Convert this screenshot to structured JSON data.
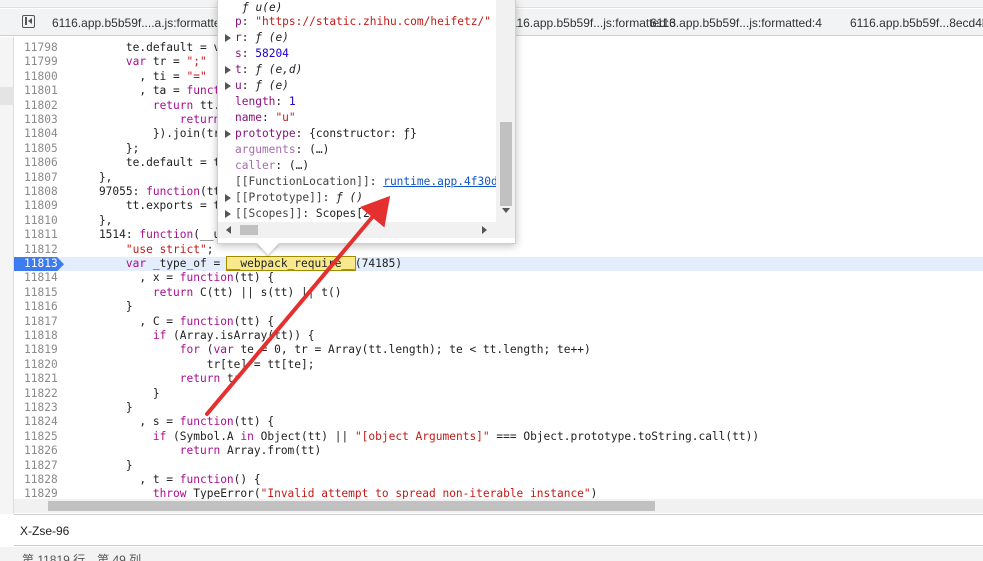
{
  "tabs": [
    {
      "label": "6116.app.b5b59f....a.js:formatted"
    },
    {
      "label": "6116.app.b5b59f...js:formatted:3"
    },
    {
      "label": "6116.app.b5b59f...js:formatted:4"
    },
    {
      "label": "6116.app.b5b59f...8ecd4b"
    }
  ],
  "code_lines": [
    {
      "n": "11798",
      "segs": [
        {
          "t": "        te.default = v",
          "c": ""
        }
      ]
    },
    {
      "n": "11799",
      "segs": [
        {
          "t": "        ",
          "c": ""
        },
        {
          "t": "var",
          "c": "kw"
        },
        {
          "t": " tr = ",
          "c": ""
        },
        {
          "t": "\";\"",
          "c": "str"
        }
      ]
    },
    {
      "n": "11800",
      "segs": [
        {
          "t": "          , ti = ",
          "c": ""
        },
        {
          "t": "\"=\"",
          "c": "str"
        }
      ]
    },
    {
      "n": "11801",
      "segs": [
        {
          "t": "          , ta = ",
          "c": ""
        },
        {
          "t": "funct",
          "c": "kw"
        }
      ]
    },
    {
      "n": "11802",
      "segs": [
        {
          "t": "            ",
          "c": ""
        },
        {
          "t": "return",
          "c": "kw"
        },
        {
          "t": " tt.",
          "c": ""
        }
      ]
    },
    {
      "n": "11803",
      "segs": [
        {
          "t": "                ",
          "c": ""
        },
        {
          "t": "return",
          "c": "kw"
        }
      ]
    },
    {
      "n": "11804",
      "segs": [
        {
          "t": "            }).join(tr",
          "c": ""
        }
      ]
    },
    {
      "n": "11805",
      "segs": [
        {
          "t": "        };",
          "c": ""
        }
      ]
    },
    {
      "n": "11806",
      "segs": [
        {
          "t": "        te.default = t",
          "c": ""
        }
      ]
    },
    {
      "n": "11807",
      "segs": [
        {
          "t": "    },",
          "c": ""
        }
      ]
    },
    {
      "n": "11808",
      "segs": [
        {
          "t": "    97055: ",
          "c": ""
        },
        {
          "t": "function",
          "c": "kw"
        },
        {
          "t": "(tt",
          "c": ""
        }
      ]
    },
    {
      "n": "11809",
      "segs": [
        {
          "t": "        tt.exports = t",
          "c": ""
        }
      ]
    },
    {
      "n": "11810",
      "segs": [
        {
          "t": "    },",
          "c": ""
        }
      ]
    },
    {
      "n": "11811",
      "segs": [
        {
          "t": "    1514: ",
          "c": ""
        },
        {
          "t": "function",
          "c": "kw"
        },
        {
          "t": "(__u                                  ire__) {",
          "c": ""
        }
      ]
    },
    {
      "n": "11812",
      "segs": [
        {
          "t": "        ",
          "c": ""
        },
        {
          "t": "\"use strict\"",
          "c": "str"
        },
        {
          "t": ";",
          "c": ""
        }
      ]
    },
    {
      "n": "11813",
      "bp": true,
      "segs": [
        {
          "t": "        ",
          "c": ""
        },
        {
          "t": "var",
          "c": "kw"
        },
        {
          "t": " _type_of = ",
          "c": ""
        },
        {
          "t": "__webpack_require__",
          "c": "hl"
        },
        {
          "t": "(74185)",
          "c": ""
        }
      ]
    },
    {
      "n": "11814",
      "segs": [
        {
          "t": "          , x = ",
          "c": ""
        },
        {
          "t": "function",
          "c": "kw"
        },
        {
          "t": "(tt) {",
          "c": ""
        }
      ]
    },
    {
      "n": "11815",
      "segs": [
        {
          "t": "            ",
          "c": ""
        },
        {
          "t": "return",
          "c": "kw"
        },
        {
          "t": " C(tt) || s(tt) || t()",
          "c": ""
        }
      ]
    },
    {
      "n": "11816",
      "segs": [
        {
          "t": "        }",
          "c": ""
        }
      ]
    },
    {
      "n": "11817",
      "segs": [
        {
          "t": "          , C = ",
          "c": ""
        },
        {
          "t": "function",
          "c": "kw"
        },
        {
          "t": "(tt) {",
          "c": ""
        }
      ]
    },
    {
      "n": "11818",
      "segs": [
        {
          "t": "            ",
          "c": ""
        },
        {
          "t": "if",
          "c": "kw"
        },
        {
          "t": " (Array.isArray(tt)) {",
          "c": ""
        }
      ]
    },
    {
      "n": "11819",
      "segs": [
        {
          "t": "                ",
          "c": ""
        },
        {
          "t": "for",
          "c": "kw"
        },
        {
          "t": " (",
          "c": ""
        },
        {
          "t": "var",
          "c": "kw"
        },
        {
          "t": " te = 0, tr = Array(tt.length); te < tt.length; te++)",
          "c": ""
        }
      ]
    },
    {
      "n": "11820",
      "segs": [
        {
          "t": "                    tr[te] = tt[te];",
          "c": ""
        }
      ]
    },
    {
      "n": "11821",
      "segs": [
        {
          "t": "                ",
          "c": ""
        },
        {
          "t": "return",
          "c": "kw"
        },
        {
          "t": " tr",
          "c": ""
        }
      ]
    },
    {
      "n": "11822",
      "segs": [
        {
          "t": "            }",
          "c": ""
        }
      ]
    },
    {
      "n": "11823",
      "segs": [
        {
          "t": "        }",
          "c": ""
        }
      ]
    },
    {
      "n": "11824",
      "segs": [
        {
          "t": "          , s = ",
          "c": ""
        },
        {
          "t": "function",
          "c": "kw"
        },
        {
          "t": "(tt) {",
          "c": ""
        }
      ]
    },
    {
      "n": "11825",
      "segs": [
        {
          "t": "            ",
          "c": ""
        },
        {
          "t": "if",
          "c": "kw"
        },
        {
          "t": " (Symbol.A ",
          "c": ""
        },
        {
          "t": "in",
          "c": "kw"
        },
        {
          "t": " Object(tt) || ",
          "c": ""
        },
        {
          "t": "\"[object Arguments]\"",
          "c": "str"
        },
        {
          "t": " === Object.prototype.toString.call(tt))",
          "c": ""
        }
      ]
    },
    {
      "n": "11826",
      "segs": [
        {
          "t": "                ",
          "c": ""
        },
        {
          "t": "return",
          "c": "kw"
        },
        {
          "t": " Array.from(tt)",
          "c": ""
        }
      ]
    },
    {
      "n": "11827",
      "segs": [
        {
          "t": "        }",
          "c": ""
        }
      ]
    },
    {
      "n": "11828",
      "segs": [
        {
          "t": "          , t = ",
          "c": ""
        },
        {
          "t": "function",
          "c": "kw"
        },
        {
          "t": "() {",
          "c": ""
        }
      ]
    },
    {
      "n": "11829",
      "segs": [
        {
          "t": "            ",
          "c": ""
        },
        {
          "t": "throw",
          "c": "kw"
        },
        {
          "t": " TypeError(",
          "c": ""
        },
        {
          "t": "\"Invalid attempt to spread non-iterable instance\"",
          "c": "str"
        },
        {
          "t": ")",
          "c": ""
        }
      ]
    }
  ],
  "popover": {
    "title": "ƒ u(e)",
    "rows": [
      {
        "tri": false,
        "key": "p",
        "sep": ": ",
        "val": "\"https://static.zhihu.com/heifetz/\"",
        "vc": "pstr",
        "kc": ""
      },
      {
        "tri": true,
        "key": "r",
        "sep": ": ",
        "val": "ƒ (e)",
        "vc": "pfn",
        "kc": ""
      },
      {
        "tri": false,
        "key": "s",
        "sep": ": ",
        "val": "58204",
        "vc": "pnum",
        "kc": ""
      },
      {
        "tri": true,
        "key": "t",
        "sep": ": ",
        "val": "ƒ (e,d)",
        "vc": "pfn",
        "kc": ""
      },
      {
        "tri": true,
        "key": "u",
        "sep": ": ",
        "val": "ƒ (e)",
        "vc": "pfn",
        "kc": ""
      },
      {
        "tri": false,
        "key": "length",
        "sep": ": ",
        "val": "1",
        "vc": "pnum",
        "kc": ""
      },
      {
        "tri": false,
        "key": "name",
        "sep": ": ",
        "val": "\"u\"",
        "vc": "pstr",
        "kc": ""
      },
      {
        "tri": true,
        "key": "prototype",
        "sep": ": ",
        "val": "{constructor: ƒ}",
        "vc": "",
        "kc": ""
      },
      {
        "tri": false,
        "key": "arguments",
        "sep": ": ",
        "val": "(…)",
        "vc": "",
        "kc": "dim"
      },
      {
        "tri": false,
        "key": "caller",
        "sep": ": ",
        "val": "(…)",
        "vc": "",
        "kc": "dim"
      },
      {
        "tri": false,
        "key": "[[FunctionLocation]]",
        "sep": ": ",
        "val": "runtime.app.4f30d",
        "vc": "plink",
        "kc": "gray"
      },
      {
        "tri": true,
        "key": "[[Prototype]]",
        "sep": ": ",
        "val": "ƒ ()",
        "vc": "pfn",
        "kc": "gray"
      },
      {
        "tri": true,
        "key": "[[Scopes]]",
        "sep": ": ",
        "val": "Scopes[2]",
        "vc": "",
        "kc": "gray"
      }
    ]
  },
  "search": {
    "value": "X-Zse-96"
  },
  "status": {
    "text": "第 11819 行，第 49 列"
  },
  "colors": {
    "annotation_arrow": "#e53030",
    "breakpoint": "#3d7bf0"
  }
}
